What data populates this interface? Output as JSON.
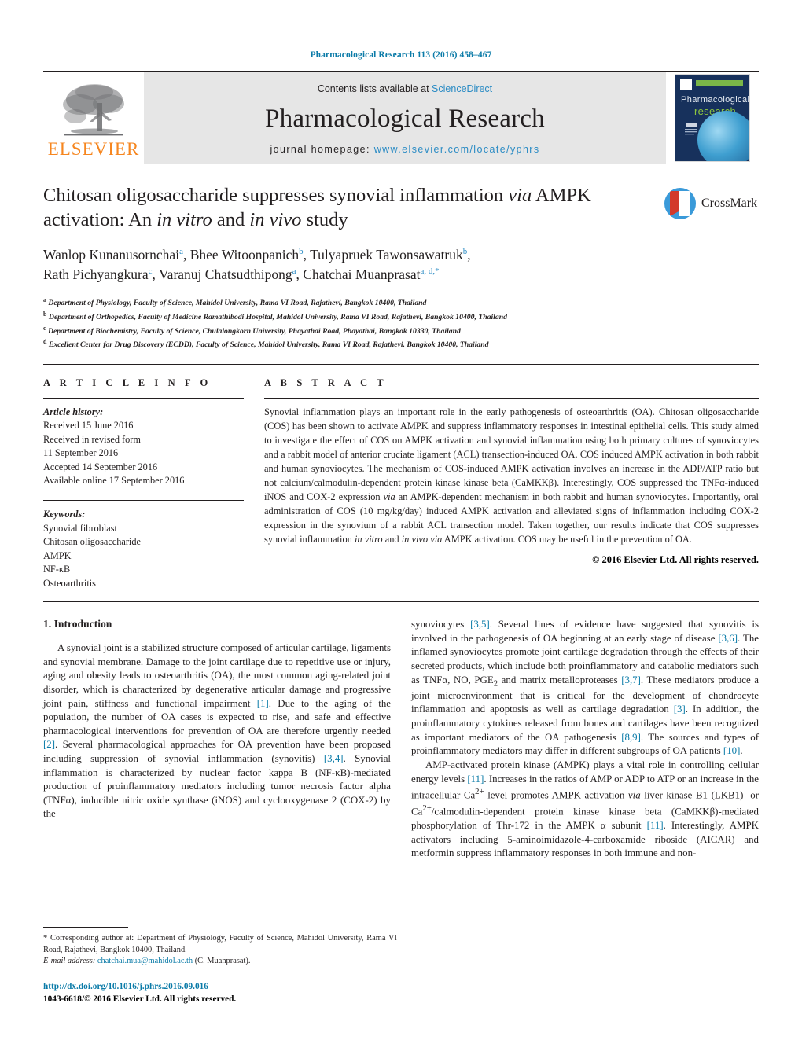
{
  "running_head": "Pharmacological Research 113 (2016) 458–467",
  "masthead": {
    "publisher_name": "ELSEVIER",
    "contents_prefix": "Contents lists available at ",
    "contents_link": "ScienceDirect",
    "journal_name": "Pharmacological Research",
    "homepage_prefix": "journal homepage: ",
    "homepage_url": "www.elsevier.com/locate/yphrs",
    "cover": {
      "line1": "Pharmacological",
      "line2": "research"
    },
    "colors": {
      "link": "#2a8bc4",
      "elsevier_orange": "#f6861f",
      "cover_navy": "#17315c",
      "cover_green": "#7ab648"
    }
  },
  "article": {
    "title_line1_a": "Chitosan oligosaccharide suppresses synovial inflammation ",
    "title_line1_i": "via",
    "title_line1_b": " AMPK",
    "title_line2_a": "activation: An ",
    "title_line2_i1": "in vitro",
    "title_line2_b": " and ",
    "title_line2_i2": "in vivo",
    "title_line2_c": " study",
    "crossmark_label": "CrossMark",
    "authors": [
      {
        "name": "Wanlop Kunanusornchai",
        "sup": "a",
        "sep": ", "
      },
      {
        "name": "Bhee Witoonpanich",
        "sup": "b",
        "sep": ", "
      },
      {
        "name": "Tulyapruek Tawonsawatruk",
        "sup": "b",
        "sep": ","
      },
      {
        "name": "Rath Pichyangkura",
        "sup": "c",
        "sep": ", "
      },
      {
        "name": "Varanuj Chatsudthipong",
        "sup": "a",
        "sep": ", "
      },
      {
        "name": "Chatchai Muanprasat",
        "sup": "a, d,",
        "sep": ""
      }
    ],
    "affiliations": [
      {
        "mark": "a",
        "text": "Department of Physiology, Faculty of Science, Mahidol University, Rama VI Road, Rajathevi, Bangkok 10400, Thailand"
      },
      {
        "mark": "b",
        "text": "Department of Orthopedics, Faculty of Medicine Ramathibodi Hospital, Mahidol University, Rama VI Road, Rajathevi, Bangkok 10400, Thailand"
      },
      {
        "mark": "c",
        "text": "Department of Biochemistry, Faculty of Science, Chulalongkorn University, Phayathai Road, Phayathai, Bangkok 10330, Thailand"
      },
      {
        "mark": "d",
        "text": "Excellent Center for Drug Discovery (ECDD), Faculty of Science, Mahidol University, Rama VI Road, Rajathevi, Bangkok 10400, Thailand"
      }
    ]
  },
  "article_info": {
    "heading": "A R T I C L E   I N F O",
    "history_label": "Article history:",
    "history": [
      "Received 15 June 2016",
      "Received in revised form",
      "11 September 2016",
      "Accepted 14 September 2016",
      "Available online 17 September 2016"
    ],
    "keywords_label": "Keywords:",
    "keywords": [
      "Synovial fibroblast",
      "Chitosan oligosaccharide",
      "AMPK",
      "NF-κB",
      "Osteoarthritis"
    ]
  },
  "abstract": {
    "heading": "A B S T R A C T",
    "part1": "Synovial inflammation plays an important role in the early pathogenesis of osteoarthritis (OA). Chitosan oligosaccharide (COS) has been shown to activate AMPK and suppress inflammatory responses in intestinal epithelial cells. This study aimed to investigate the effect of COS on AMPK activation and synovial inflammation using both primary cultures of synoviocytes and a rabbit model of anterior cruciate ligament (ACL) transection-induced OA. COS induced AMPK activation in both rabbit and human synoviocytes. The mechanism of COS-induced AMPK activation involves an increase in the ADP/ATP ratio but not calcium/calmodulin-dependent protein kinase kinase beta (CaMKKβ). Interestingly, COS suppressed the TNFα-induced iNOS and COX-2 expression ",
    "i1": "via",
    "part2": " an AMPK-dependent mechanism in both rabbit and human synoviocytes. Importantly, oral administration of COS (10 mg/kg/day) induced AMPK activation and alleviated signs of inflammation including COX-2 expression in the synovium of a rabbit ACL transection model. Taken together, our results indicate that COS suppresses synovial inflammation ",
    "i2": "in vitro",
    "part3": " and ",
    "i3": "in vivo via",
    "part4": " AMPK activation. COS may be useful in the prevention of OA.",
    "copyright": "© 2016 Elsevier Ltd. All rights reserved."
  },
  "intro": {
    "heading": "1.  Introduction",
    "left_p1_a": "A synovial joint is a stabilized structure composed of articular cartilage, ligaments and synovial membrane. Damage to the joint cartilage due to repetitive use or injury, aging and obesity leads to osteoarthritis (OA), the most common aging-related joint disorder, which is characterized by degenerative articular damage and progressive joint pain, stiffness and functional impairment ",
    "left_r1": "[1]",
    "left_p1_b": ". Due to the aging of the population, the number of OA cases is expected to rise, and safe and effective pharmacological interventions for prevention of OA are therefore urgently needed ",
    "left_r2": "[2]",
    "left_p1_c": ". Several pharmacological approaches for OA prevention have been proposed including suppression of synovial inflammation (synovitis) ",
    "left_r3": "[3,4]",
    "left_p1_d": ". Synovial inflammation is characterized by nuclear factor kappa B (NF-κB)-mediated production of proinflammatory mediators including tumor necrosis factor alpha (TNFα), inducible nitric oxide synthase (iNOS) and cyclooxygenase 2 (COX-2) by the",
    "right_p1_a": "synoviocytes ",
    "right_r1": "[3,5]",
    "right_p1_b": ". Several lines of evidence have suggested that synovitis is involved in the pathogenesis of OA beginning at an early stage of disease ",
    "right_r2": "[3,6]",
    "right_p1_c": ". The inflamed synoviocytes promote joint cartilage degradation through the effects of their secreted products, which include both proinflammatory and catabolic mediators such as TNFα, NO, PGE",
    "right_sub": "2",
    "right_p1_d": " and matrix metalloproteases ",
    "right_r3": "[3,7]",
    "right_p1_e": ". These mediators produce a joint microenvironment that is critical for the development of chondrocyte inflammation and apoptosis as well as cartilage degradation ",
    "right_r4": "[3]",
    "right_p1_f": ". In addition, the proinflammatory cytokines released from bones and cartilages have been recognized as important mediators of the OA pathogenesis ",
    "right_r5": "[8,9]",
    "right_p1_g": ". The sources and types of proinflammatory mediators may differ in different subgroups of OA patients ",
    "right_r6": "[10]",
    "right_p1_h": ".",
    "right_p2_a": "AMP-activated protein kinase (AMPK) plays a vital role in controlling cellular energy levels ",
    "right_r7": "[11]",
    "right_p2_b": ". Increases in the ratios of AMP or ADP to ATP or an increase in the intracellular Ca",
    "right_sup1": "2+",
    "right_p2_c": " level promotes AMPK activation ",
    "right_i1": "via",
    "right_p2_d": " liver kinase B1 (LKB1)- or Ca",
    "right_sup2": "2+",
    "right_p2_e": "/calmodulin-dependent protein kinase kinase beta (CaMKKβ)-mediated phosphorylation of Thr-172 in the AMPK α subunit ",
    "right_r8": "[11]",
    "right_p2_f": ". Interestingly, AMPK activators including 5-aminoimidazole-4-carboxamide riboside (AICAR) and metformin suppress inflammatory responses in both immune and non-"
  },
  "footer": {
    "corresponding_mark": "*",
    "corresponding_text": " Corresponding author at: Department of Physiology, Faculty of Science, Mahidol University, Rama VI Road, Rajathevi, Bangkok 10400, Thailand.",
    "email_label": "E-mail address:",
    "email": "chatchai.mua@mahidol.ac.th",
    "email_owner": " (C. Muanprasat).",
    "doi": "http://dx.doi.org/10.1016/j.phrs.2016.09.016",
    "issn": "1043-6618/© 2016 Elsevier Ltd. All rights reserved."
  }
}
